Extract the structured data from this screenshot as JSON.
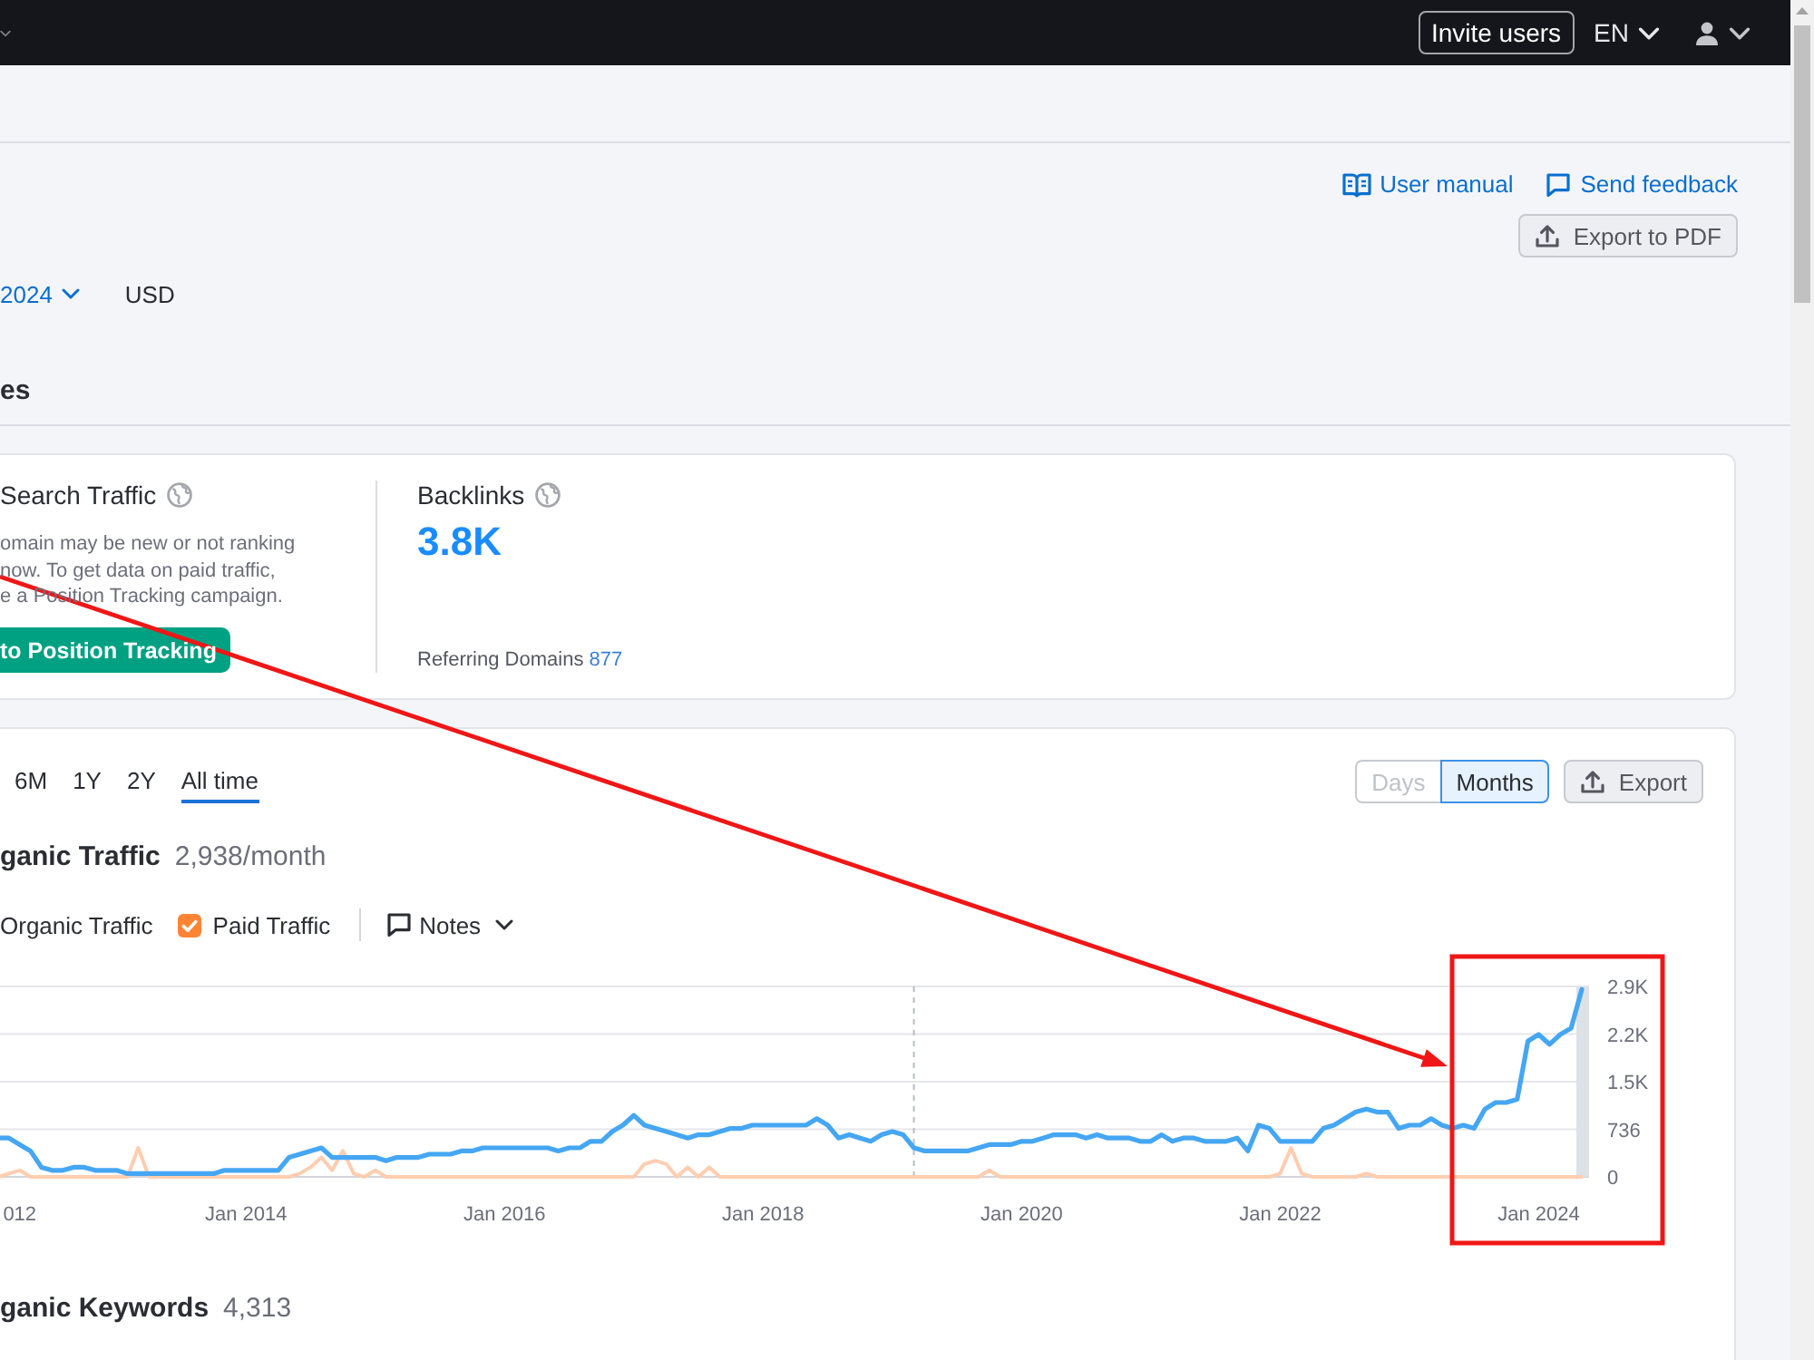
{
  "top_bar": {
    "invite_button": "Invite users",
    "language": "EN"
  },
  "header": {
    "links": [
      {
        "kind": "manual",
        "label": "User manual"
      },
      {
        "kind": "feedback",
        "label": "Send feedback"
      }
    ],
    "export_button": "Export to PDF",
    "date_picker": "2024",
    "currency": "USD",
    "section_title": "es"
  },
  "summary": {
    "paid_search": {
      "title": "Search Traffic",
      "description": "omain may be new or not ranking\nnow. To get data on paid traffic,\ne a Position Tracking campaign.",
      "button": "to Position Tracking"
    },
    "backlinks": {
      "title": "Backlinks",
      "value": "3.8K",
      "referring_label": "Referring Domains",
      "referring_value": "877"
    }
  },
  "traffic": {
    "periods": [
      {
        "label": "6M",
        "selected": false
      },
      {
        "label": "1Y",
        "selected": false
      },
      {
        "label": "2Y",
        "selected": false
      },
      {
        "label": "All time",
        "selected": true
      }
    ],
    "granularity": [
      {
        "label": "Days",
        "selected": false,
        "disabled": true
      },
      {
        "label": "Months",
        "selected": true,
        "disabled": false
      }
    ],
    "export_button": "Export",
    "title": "ganic Traffic",
    "total": "2,938/month",
    "legend": {
      "paid_checked": true,
      "notes_button": "Notes"
    },
    "chart_data": {
      "type": "line",
      "categories": [
        null,
        null,
        "012",
        null,
        null,
        null,
        null,
        null,
        null,
        null,
        null,
        null,
        null,
        null,
        null,
        null,
        null,
        null,
        null,
        null,
        null,
        null,
        null,
        "Jan 2014",
        null,
        null,
        null,
        null,
        null,
        null,
        null,
        null,
        null,
        null,
        null,
        null,
        null,
        null,
        null,
        null,
        null,
        null,
        null,
        null,
        null,
        null,
        null,
        "Jan 2016",
        null,
        null,
        null,
        null,
        null,
        null,
        null,
        null,
        null,
        null,
        null,
        null,
        null,
        null,
        null,
        null,
        null,
        null,
        null,
        null,
        null,
        null,
        null,
        "Jan 2018",
        null,
        null,
        null,
        null,
        null,
        null,
        null,
        null,
        null,
        null,
        null,
        null,
        null,
        null,
        null,
        null,
        null,
        null,
        null,
        null,
        null,
        null,
        null,
        "Jan 2020",
        null,
        null,
        null,
        null,
        null,
        null,
        null,
        null,
        null,
        null,
        null,
        null,
        null,
        null,
        null,
        null,
        null,
        null,
        null,
        null,
        null,
        null,
        null,
        "Jan 2022",
        null,
        null,
        null,
        null,
        null,
        null,
        null,
        null,
        null,
        null,
        null,
        null,
        null,
        null,
        null,
        null,
        null,
        null,
        null,
        null,
        null,
        null,
        null,
        "Jan 2024",
        null,
        null,
        null,
        null
      ],
      "series": [
        {
          "name": "Organic Traffic",
          "color": "#45a6f3",
          "values": [
            600,
            600,
            500,
            400,
            150,
            100,
            100,
            150,
            150,
            100,
            100,
            100,
            50,
            50,
            50,
            50,
            50,
            50,
            50,
            50,
            50,
            100,
            100,
            100,
            100,
            100,
            100,
            300,
            350,
            400,
            450,
            300,
            300,
            300,
            300,
            300,
            250,
            300,
            300,
            300,
            350,
            350,
            350,
            400,
            400,
            450,
            450,
            450,
            450,
            450,
            450,
            450,
            400,
            450,
            450,
            550,
            550,
            700,
            800,
            950,
            800,
            750,
            700,
            650,
            600,
            650,
            650,
            700,
            750,
            750,
            800,
            800,
            800,
            800,
            800,
            800,
            900,
            800,
            600,
            650,
            600,
            550,
            650,
            700,
            650,
            450,
            400,
            400,
            400,
            400,
            400,
            450,
            500,
            500,
            500,
            550,
            550,
            600,
            650,
            650,
            650,
            600,
            650,
            600,
            600,
            600,
            550,
            550,
            650,
            550,
            600,
            600,
            550,
            550,
            550,
            600,
            400,
            800,
            750,
            550,
            550,
            550,
            550,
            750,
            800,
            900,
            1000,
            1050,
            1000,
            1000,
            750,
            800,
            800,
            900,
            800,
            750,
            800,
            750,
            1050,
            1150,
            1150,
            1200,
            2100,
            2200,
            2050,
            2200,
            2300,
            2900
          ]
        },
        {
          "name": "Paid Traffic",
          "color": "#ffcdb0",
          "values": [
            0,
            50,
            100,
            0,
            0,
            0,
            0,
            0,
            0,
            0,
            0,
            0,
            0,
            450,
            0,
            0,
            0,
            0,
            0,
            0,
            0,
            0,
            0,
            0,
            0,
            0,
            0,
            0,
            50,
            150,
            300,
            100,
            400,
            50,
            0,
            100,
            0,
            0,
            0,
            0,
            0,
            0,
            0,
            0,
            0,
            0,
            0,
            0,
            0,
            0,
            0,
            0,
            0,
            0,
            0,
            0,
            0,
            0,
            0,
            0,
            200,
            250,
            200,
            0,
            150,
            0,
            150,
            0,
            0,
            0,
            0,
            0,
            0,
            0,
            0,
            0,
            0,
            0,
            0,
            0,
            0,
            0,
            0,
            0,
            0,
            0,
            0,
            0,
            0,
            0,
            0,
            0,
            100,
            0,
            0,
            0,
            0,
            0,
            0,
            0,
            0,
            0,
            0,
            0,
            0,
            0,
            0,
            0,
            0,
            0,
            0,
            0,
            0,
            0,
            0,
            0,
            0,
            0,
            0,
            50,
            450,
            50,
            0,
            0,
            0,
            0,
            0,
            50,
            0,
            0,
            0,
            0,
            0,
            0,
            0,
            0,
            0,
            0,
            0,
            0,
            0,
            0,
            0,
            0,
            0,
            0,
            0,
            0
          ]
        }
      ],
      "ylim": [
        0,
        2944
      ],
      "yticks": [
        {
          "value": 0,
          "label": "0"
        },
        {
          "value": 736,
          "label": "736"
        },
        {
          "value": 1472,
          "label": "1.5K"
        },
        {
          "value": 2208,
          "label": "2.2K"
        },
        {
          "value": 2944,
          "label": "2.9K"
        }
      ],
      "grid": true
    }
  },
  "keywords": {
    "title": "ganic Keywords",
    "total": "4,313"
  }
}
